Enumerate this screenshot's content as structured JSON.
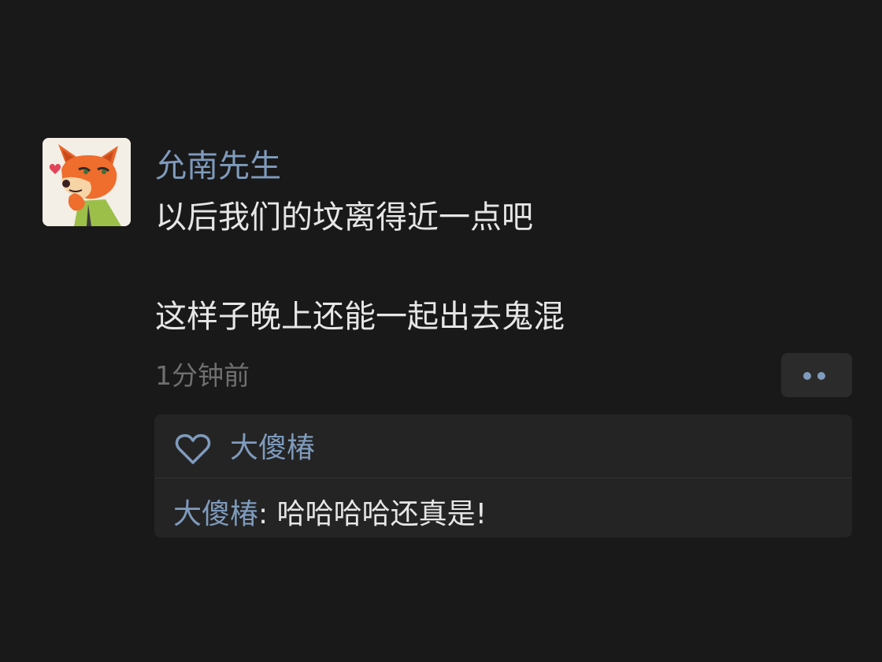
{
  "post": {
    "author": "允南先生",
    "content_lines": [
      "以后我们的坟离得近一点吧",
      "这样子晚上还能一起出去鬼混"
    ],
    "time": "1分钟前"
  },
  "likes": {
    "names": "大傻椿"
  },
  "comments": [
    {
      "author": "大傻椿",
      "separator": ": ",
      "text": "哈哈哈哈还真是!"
    }
  ],
  "icons": {
    "avatar": "fox-cartoon-avatar",
    "like": "heart-outline-icon",
    "more": "more-dots-icon"
  },
  "colors": {
    "background": "#191919",
    "link": "#7f9bbd",
    "text": "#e6e6e6",
    "muted": "#6f6f6f"
  }
}
